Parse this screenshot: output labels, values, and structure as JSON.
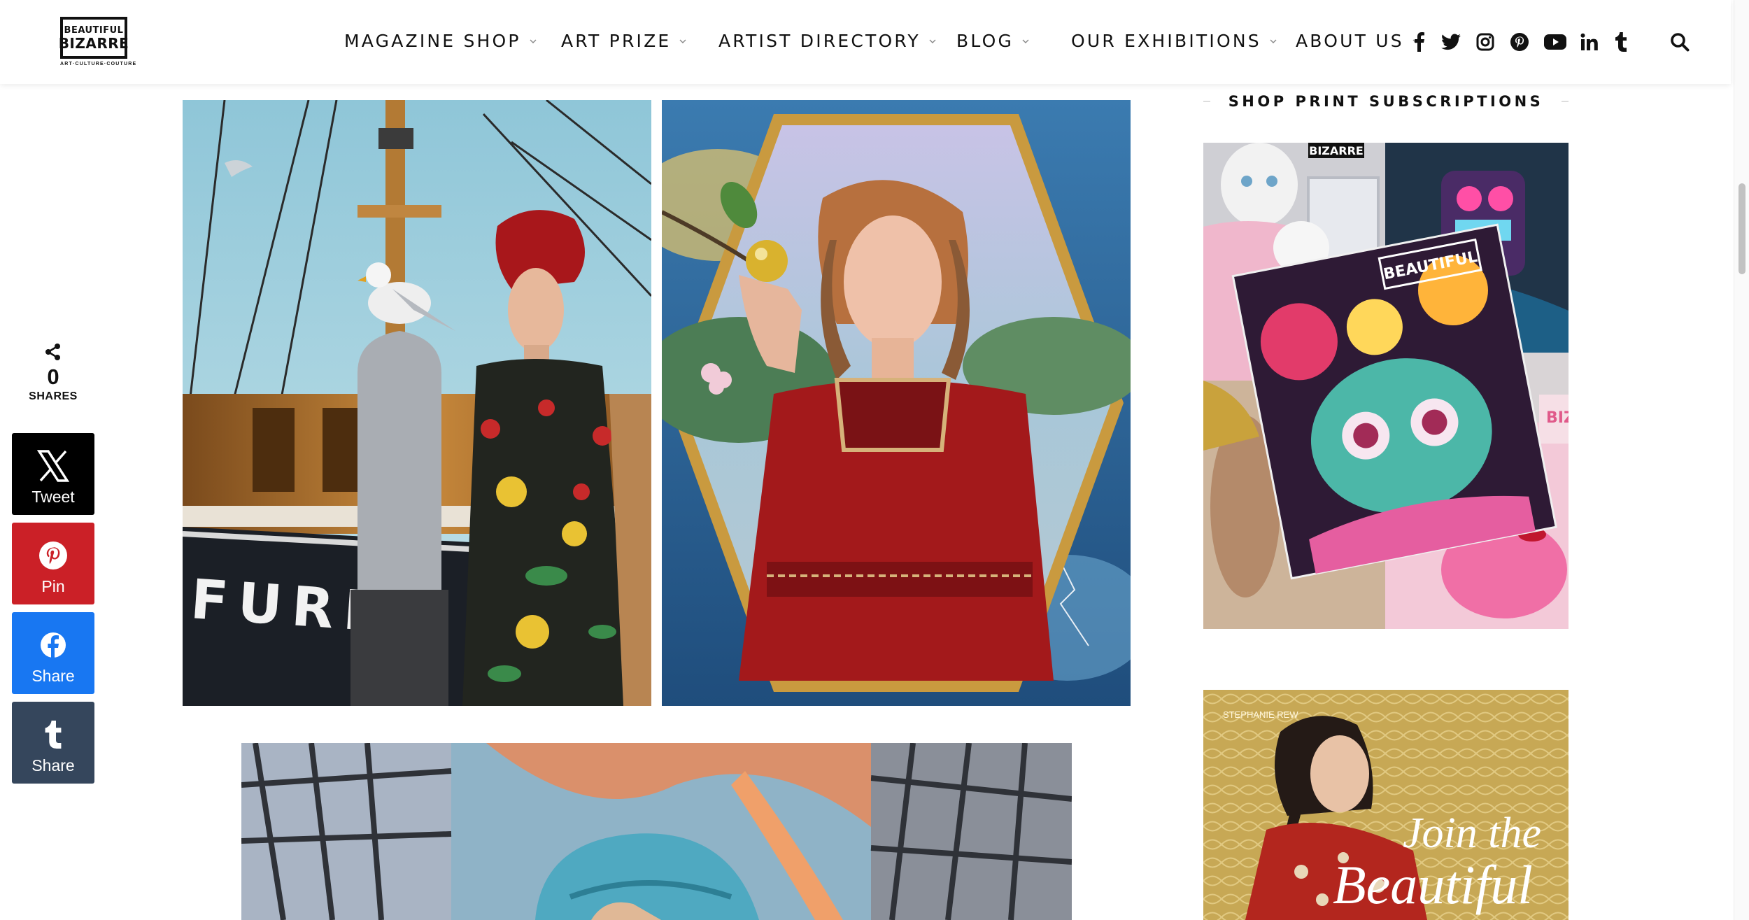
{
  "logo": {
    "line1": "BEAUTIFUL",
    "line2": "BIZARRE",
    "tagline": "ART·CULTURE·COUTURE"
  },
  "nav": [
    {
      "label": "MAGAZINE SHOP"
    },
    {
      "label": "ART PRIZE"
    },
    {
      "label": "ARTIST DIRECTORY"
    },
    {
      "label": "BLOG"
    },
    {
      "label": "OUR EXHIBITIONS"
    },
    {
      "label": "ABOUT US"
    }
  ],
  "social_icons": [
    "facebook-icon",
    "twitter-icon",
    "instagram-icon",
    "pinterest-icon",
    "youtube-icon",
    "linkedin-icon",
    "tumblr-icon",
    "search-icon"
  ],
  "share": {
    "count": "0",
    "count_label": "SHARES",
    "buttons": [
      {
        "label": "Tweet",
        "icon": "x-icon",
        "color": "#000000"
      },
      {
        "label": "Pin",
        "icon": "pinterest-icon",
        "color": "#cb2027"
      },
      {
        "label": "Share",
        "icon": "facebook-icon",
        "color": "#1877f2"
      },
      {
        "label": "Share",
        "icon": "tumblr-icon",
        "color": "#35465c"
      }
    ]
  },
  "article_images": {
    "painting1_text": "FURIE"
  },
  "sidebar": {
    "title": "SHOP PRINT SUBSCRIPTIONS",
    "promo_credit": "STEPHANIE REW",
    "promo_line1": "Join the",
    "promo_line2": "Beautiful",
    "cover_mark1": "BIZARRE",
    "cover_mark2": "BEAUTIFUL",
    "cover_mark3": "BIZ"
  },
  "colors": {
    "nav_text": "#111111",
    "brand": "#000000"
  }
}
